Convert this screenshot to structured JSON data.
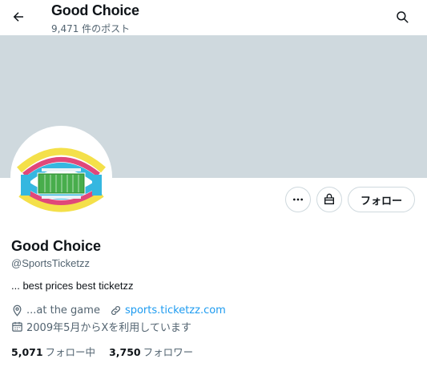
{
  "header": {
    "title": "Good Choice",
    "post_count": "9,471 件のポスト",
    "back_icon": "arrow-left-icon",
    "search_icon": "search-icon"
  },
  "colors": {
    "banner": "#cfd9de",
    "link": "#1d9bf0",
    "secondary_text": "#536471"
  },
  "profile": {
    "avatar_icon": "stadium-seating-map",
    "name": "Good Choice",
    "handle": "@SportsTicketzz",
    "bio": "... best prices best ticketzz",
    "location": "...at the game",
    "website": "sports.ticketzz.com",
    "joined": "2009年5月からXを利用しています"
  },
  "actions": {
    "more_icon": "more-icon",
    "shop_icon": "shop-icon",
    "follow_label": "フォロー"
  },
  "stats": {
    "following_count": "5,071",
    "following_label": "フォロー中",
    "followers_count": "3,750",
    "followers_label": "フォロワー"
  }
}
